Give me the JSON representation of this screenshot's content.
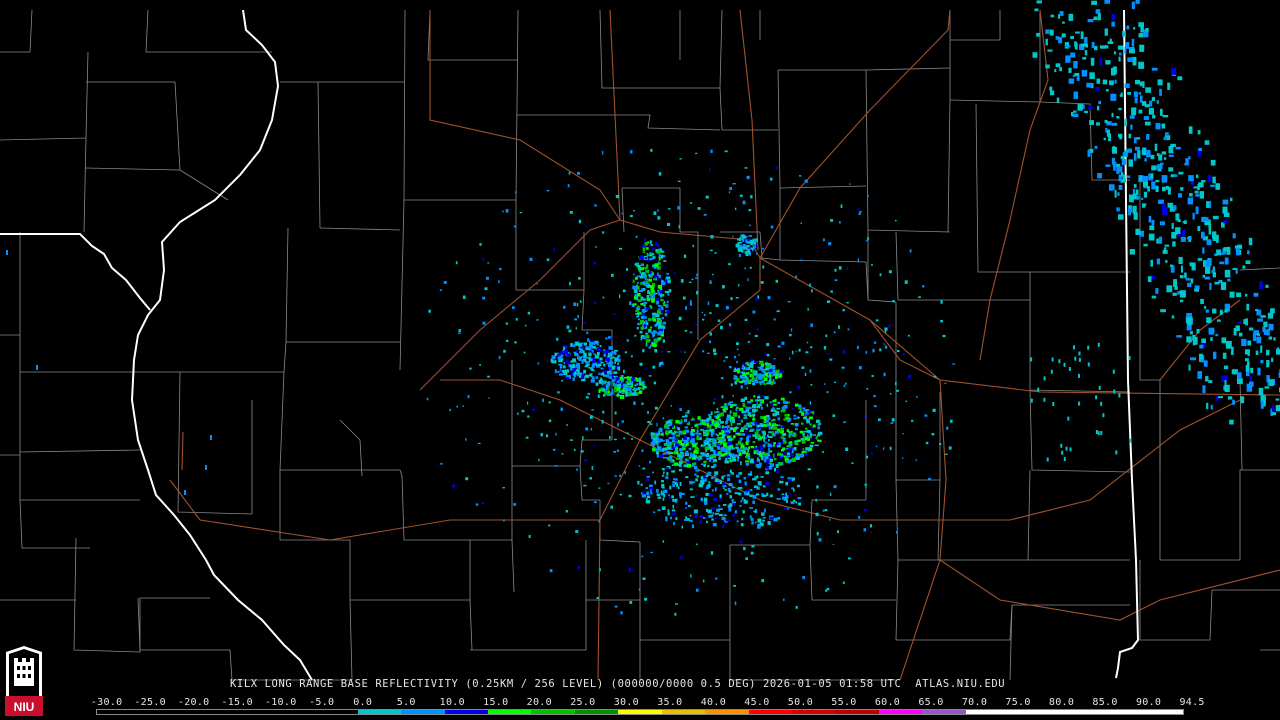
{
  "product": {
    "title": "KILX LONG RANGE BASE REFLECTIVITY (0.25KM / 256 LEVEL) (000000/0000 0.5 DEG) 2026-01-05 01:58 UTC  ATLAS.NIU.EDU",
    "radar_site": "KILX",
    "timestamp": "2026-01-05 01:58 UTC",
    "source": "ATLAS.NIU.EDU"
  },
  "logo": {
    "text": "NIU",
    "icon": "niu-castle-logo-icon",
    "colors": {
      "red": "#c8102e",
      "white": "#ffffff",
      "black": "#000000"
    }
  },
  "map": {
    "background": "#000000",
    "colors": {
      "county_lines": "#8a8a8a",
      "state_lines": "#ffffff",
      "highways": "#a0522d"
    }
  },
  "scale": {
    "labels": [
      "-30.0",
      "-25.0",
      "-20.0",
      "-15.0",
      "-10.0",
      "-5.0",
      "0.0",
      "5.0",
      "10.0",
      "15.0",
      "20.0",
      "25.0",
      "30.0",
      "35.0",
      "40.0",
      "45.0",
      "50.0",
      "55.0",
      "60.0",
      "65.0",
      "70.0",
      "75.0",
      "80.0",
      "85.0",
      "90.0",
      "94.5"
    ],
    "colors": [
      "#000000",
      "#000000",
      "#000000",
      "#000000",
      "#000000",
      "#000000",
      "#00c8c8",
      "#0090ff",
      "#0000e8",
      "#00ff00",
      "#00c000",
      "#009000",
      "#ffff00",
      "#e7c000",
      "#ff9000",
      "#ff0000",
      "#d60000",
      "#c00000",
      "#ff00ff",
      "#9955c9",
      "#ffffff",
      "#ffffff",
      "#ffffff",
      "#ffffff",
      "#ffffff"
    ]
  }
}
